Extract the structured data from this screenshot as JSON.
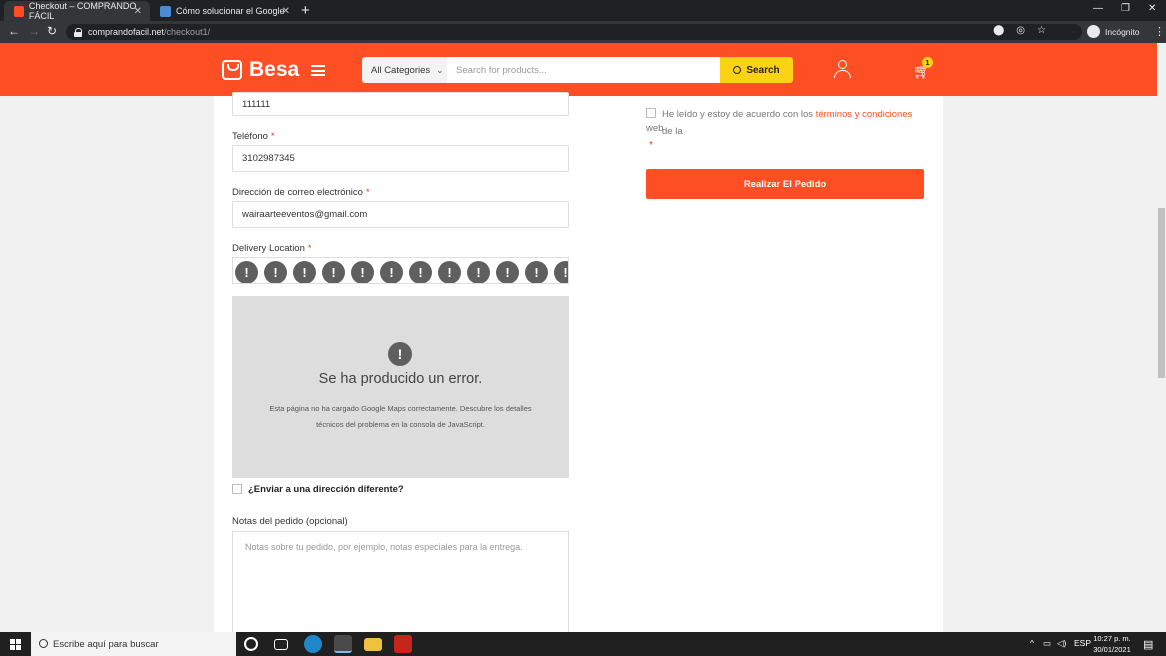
{
  "browser": {
    "tabs": [
      {
        "title": "Checkout – COMPRANDO FÁCIL",
        "active": true
      },
      {
        "title": "Cómo solucionar el Google Maps",
        "active": false
      }
    ],
    "url_host": "comprandofacil.net",
    "url_path": "/checkout1/",
    "profile_label": "Incógnito"
  },
  "header": {
    "logo": "Besa",
    "category_label": "All Categories",
    "search_placeholder": "Search for products...",
    "search_button": "Search",
    "cart_count": "1",
    "brand_color": "#fe4f24",
    "accent_color": "#fbd216"
  },
  "form": {
    "top_value": "111111",
    "phone_label": "Teléfono",
    "phone_value": "3102987345",
    "email_label": "Dirección de correo electrónico",
    "email_value": "wairaarteeventos@gmail.com",
    "delivery_label": "Delivery Location",
    "required_mark": "*",
    "marker_glyph": "!",
    "map_error_title": "Se ha producido un error.",
    "map_error_desc": "Esta página no ha cargado Google Maps correctamente. Descubre los detalles técnicos del problema en la consola de JavaScript.",
    "ship_different": "¿Enviar a una dirección diferente?",
    "notes_label": "Notas del pedido (opcional)",
    "notes_placeholder": "Notas sobre tu pedido, por ejemplo, notas especiales para la entrega."
  },
  "order": {
    "terms_text": "He leído y estoy de acuerdo con los ",
    "terms_link": "términos y condiciones",
    "terms_text_after": " de la",
    "terms_text_2": "web",
    "place_order": "Realizar El Pedido"
  },
  "taskbar": {
    "search_placeholder": "Escribe aquí para buscar",
    "lang": "ESP",
    "time": "10:27 p. m.",
    "date": "30/01/2021"
  }
}
